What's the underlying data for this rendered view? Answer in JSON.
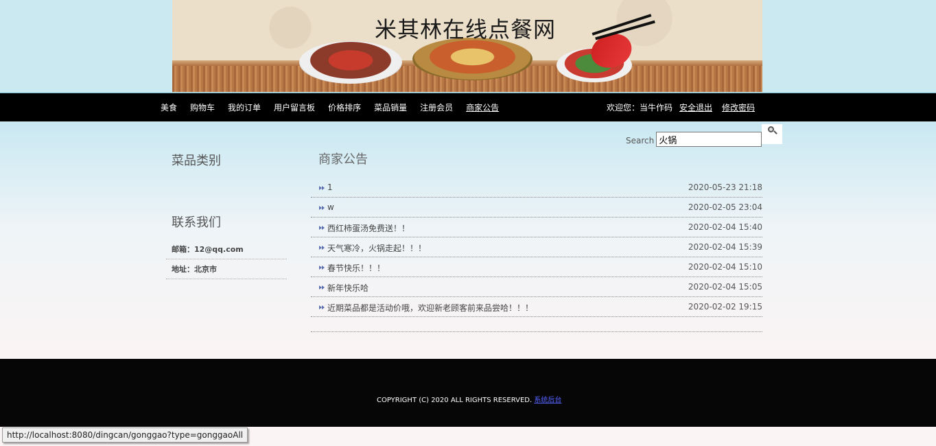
{
  "banner": {
    "title": "米其林在线点餐网"
  },
  "nav": {
    "items": [
      {
        "label": "美食",
        "active": false
      },
      {
        "label": "购物车",
        "active": false
      },
      {
        "label": "我的订单",
        "active": false
      },
      {
        "label": "用户留言板",
        "active": false
      },
      {
        "label": "价格排序",
        "active": false
      },
      {
        "label": "菜品销量",
        "active": false
      },
      {
        "label": "注册会员",
        "active": false
      },
      {
        "label": "商家公告",
        "active": true
      }
    ],
    "welcome": "欢迎您：当牛作码",
    "logout": "安全退出",
    "change_password": "修改密码"
  },
  "search": {
    "label": "Search",
    "value": "火锅",
    "button_icon": "search-icon"
  },
  "sidebar": {
    "category_title": "菜品类别",
    "contact_title": "联系我们",
    "email": "邮箱：12@qq.com",
    "address": "地址：北京市"
  },
  "main": {
    "title": "商家公告",
    "notices": [
      {
        "title": "1",
        "date": "2020-05-23 21:18"
      },
      {
        "title": "w",
        "date": "2020-02-05 23:04"
      },
      {
        "title": "西红柿蛋汤免费送！！",
        "date": "2020-02-04 15:40"
      },
      {
        "title": "天气寒冷，火锅走起！！！",
        "date": "2020-02-04 15:39"
      },
      {
        "title": "春节快乐！！！",
        "date": "2020-02-04 15:10"
      },
      {
        "title": "新年快乐哈",
        "date": "2020-02-04 15:05"
      },
      {
        "title": "近期菜品都是活动价哦，欢迎新老顾客前来品尝哈！！！",
        "date": "2020-02-02 19:15"
      }
    ]
  },
  "footer": {
    "copyright": "COPYRIGHT (C) 2020 ALL RIGHTS RESERVED.",
    "admin_link": "系统后台"
  },
  "status_url": "http://localhost:8080/dingcan/gonggao?type=gonggaoAll",
  "colors": {
    "nav_bg": "#000000",
    "footer_bg": "#060606",
    "link_blue": "#5563ff"
  }
}
